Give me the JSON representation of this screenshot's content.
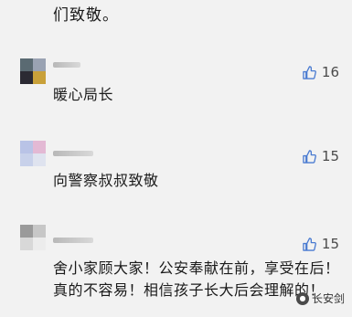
{
  "top_text": "们致敬。",
  "comments": [
    {
      "text": "暖心局长",
      "likes": "16"
    },
    {
      "text": "向警察叔叔致敬",
      "likes": "15"
    },
    {
      "text_lines": [
        "舍小家顾大家！公安奉献在前，享受在后！",
        "真的不容易！相信孩子长大后会理解的！"
      ],
      "likes": "15"
    }
  ],
  "watermark": {
    "text": "长安剑",
    "icon": "brand-logo-icon"
  },
  "colors": {
    "background": "#f2f2f2",
    "like_icon": "#4a7bd1"
  }
}
